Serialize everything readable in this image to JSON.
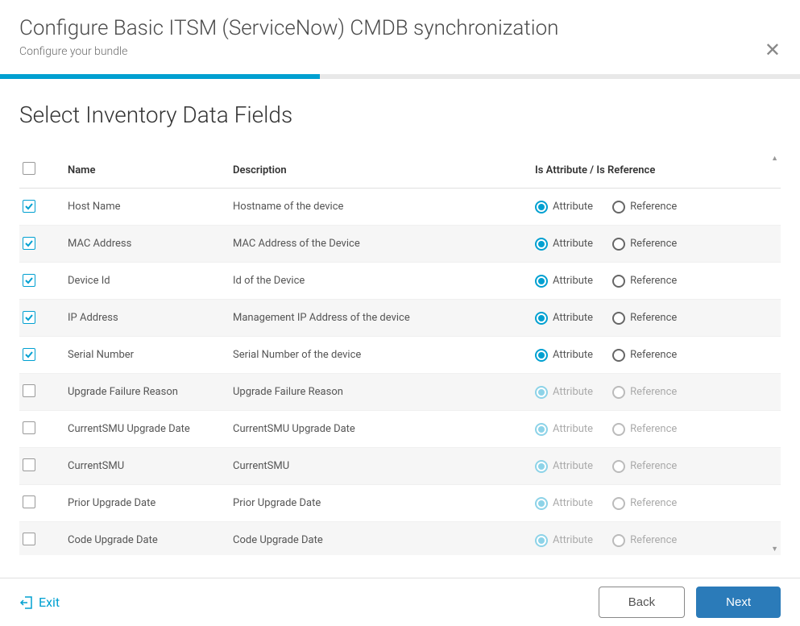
{
  "header": {
    "title": "Configure Basic ITSM (ServiceNow) CMDB synchronization",
    "subtitle": "Configure your bundle"
  },
  "section": {
    "title": "Select Inventory Data Fields"
  },
  "table": {
    "headers": {
      "name": "Name",
      "description": "Description",
      "attr_ref": "Is Attribute / Is Reference"
    },
    "labels": {
      "attribute": "Attribute",
      "reference": "Reference"
    },
    "rows": [
      {
        "name": "Host Name",
        "description": "Hostname of the device",
        "checked": true,
        "selection": "attribute",
        "enabled": true
      },
      {
        "name": "MAC Address",
        "description": "MAC Address of the Device",
        "checked": true,
        "selection": "attribute",
        "enabled": true
      },
      {
        "name": "Device Id",
        "description": "Id of the Device",
        "checked": true,
        "selection": "attribute",
        "enabled": true
      },
      {
        "name": "IP Address",
        "description": "Management IP Address of the device",
        "checked": true,
        "selection": "attribute",
        "enabled": true
      },
      {
        "name": "Serial Number",
        "description": "Serial Number of the device",
        "checked": true,
        "selection": "attribute",
        "enabled": true
      },
      {
        "name": "Upgrade Failure Reason",
        "description": "Upgrade Failure Reason",
        "checked": false,
        "selection": "attribute",
        "enabled": false
      },
      {
        "name": "CurrentSMU Upgrade Date",
        "description": "CurrentSMU Upgrade Date",
        "checked": false,
        "selection": "attribute",
        "enabled": false
      },
      {
        "name": "CurrentSMU",
        "description": "CurrentSMU",
        "checked": false,
        "selection": "attribute",
        "enabled": false
      },
      {
        "name": "Prior Upgrade Date",
        "description": "Prior Upgrade Date",
        "checked": false,
        "selection": "attribute",
        "enabled": false
      },
      {
        "name": "Code Upgrade Date",
        "description": "Code Upgrade Date",
        "checked": false,
        "selection": "attribute",
        "enabled": false
      }
    ]
  },
  "footer": {
    "exit": "Exit",
    "back": "Back",
    "next": "Next"
  }
}
